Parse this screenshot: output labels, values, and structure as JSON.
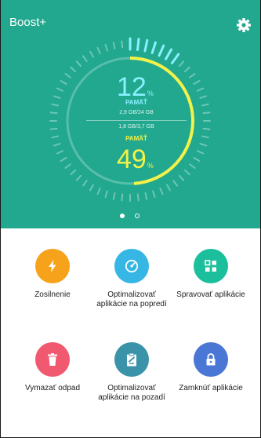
{
  "header": {
    "title": "Boost+"
  },
  "gauge": {
    "memory_percent": "12",
    "memory_unit": "%",
    "memory_label": "PAMÄŤ",
    "memory_detail": "2,9 GB/24 GB",
    "storage_detail": "1,8 GB/3,7 GB",
    "storage_label": "PAMÄŤ",
    "storage_percent": "49",
    "storage_unit": "%",
    "memory_fraction": 0.12,
    "storage_fraction": 0.49
  },
  "pager": {
    "pages": 2,
    "active": 0
  },
  "actions": [
    {
      "label": "Zosilnenie",
      "icon": "lightning-icon",
      "color": "#f6a21a"
    },
    {
      "label": "Optimalizovať aplikácie na popredí",
      "icon": "speedometer-icon",
      "color": "#35b6e4"
    },
    {
      "label": "Spravovať aplikácie",
      "icon": "grid-apps-icon",
      "color": "#1bbf9c"
    },
    {
      "label": "Vymazať odpad",
      "icon": "trash-icon",
      "color": "#f0596f"
    },
    {
      "label": "Optimalizovať aplikácie na pozadí",
      "icon": "clipboard-icon",
      "color": "#3a93a8"
    },
    {
      "label": "Zamknúť aplikácie",
      "icon": "lock-icon",
      "color": "#4a77d6"
    }
  ],
  "colors": {
    "hero_bg": "#21a88e",
    "memory_accent": "#8af0ff",
    "storage_accent": "#f2f24a"
  }
}
